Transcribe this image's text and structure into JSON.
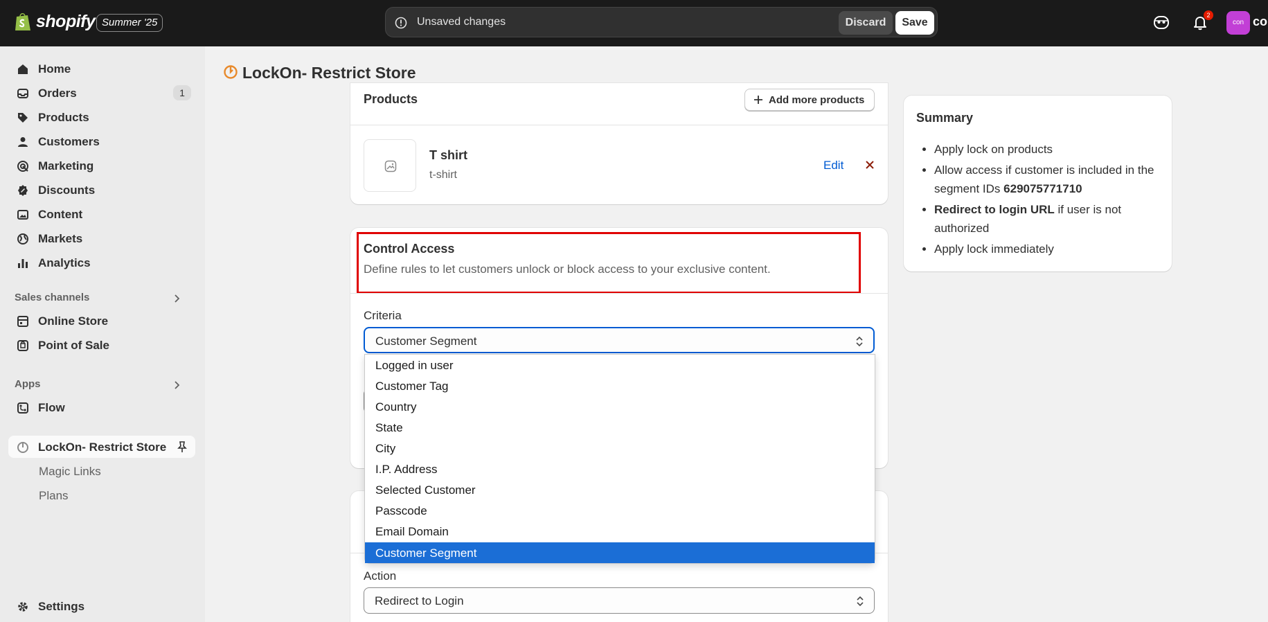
{
  "topbar": {
    "brand": "shopify",
    "edition": "Summer '25",
    "unsaved_text": "Unsaved changes",
    "discard_label": "Discard",
    "save_label": "Save",
    "notification_count": "2",
    "avatar_initials": "con",
    "avatar_name": "co"
  },
  "sidebar": {
    "items": [
      {
        "label": "Home"
      },
      {
        "label": "Orders",
        "count": "1"
      },
      {
        "label": "Products"
      },
      {
        "label": "Customers"
      },
      {
        "label": "Marketing"
      },
      {
        "label": "Discounts"
      },
      {
        "label": "Content"
      },
      {
        "label": "Markets"
      },
      {
        "label": "Analytics"
      }
    ],
    "sales_channels_heading": "Sales channels",
    "sales_channels": [
      {
        "label": "Online Store"
      },
      {
        "label": "Point of Sale"
      }
    ],
    "apps_heading": "Apps",
    "apps": [
      {
        "label": "Flow"
      },
      {
        "label": "LockOn- Restrict Store"
      }
    ],
    "app_subitems": [
      {
        "label": "Magic Links"
      },
      {
        "label": "Plans"
      }
    ],
    "settings_label": "Settings"
  },
  "page": {
    "title": "LockOn- Restrict Store"
  },
  "products_card": {
    "title": "Products",
    "add_more_label": "Add more products",
    "product_name": "T shirt",
    "product_handle": "t-shirt",
    "edit_label": "Edit"
  },
  "access_card": {
    "title": "Control Access",
    "description": "Define rules to let customers unlock or block access to your exclusive content.",
    "criteria_label": "Criteria",
    "criteria_value": "Customer Segment"
  },
  "dropdown": {
    "options": [
      "Logged in user",
      "Customer Tag",
      "Country",
      "State",
      "City",
      "I.P. Address",
      "Selected Customer",
      "Passcode",
      "Email Domain",
      "Customer Segment"
    ],
    "selected": "Customer Segment"
  },
  "action_card": {
    "action_label": "Action",
    "action_value": "Redirect to Login"
  },
  "summary": {
    "title": "Summary",
    "item1": "Apply lock on products",
    "item2_text": "Allow access if customer is included in the segment IDs ",
    "item2_bold": "629075771710",
    "item3_bold": "Redirect to login URL",
    "item3_text": " if user is not authorized",
    "item4": "Apply lock immediately"
  }
}
